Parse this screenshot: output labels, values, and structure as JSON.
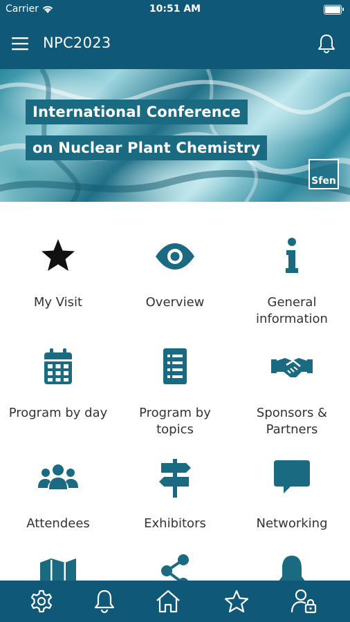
{
  "status_bar": {
    "carrier": "Carrier",
    "time": "10:51 AM"
  },
  "nav": {
    "title": "NPC2023",
    "menu_icon": "hamburger-menu-icon",
    "notification_icon": "bell-icon"
  },
  "banner": {
    "line1": "International Conference",
    "line2": "on Nuclear Plant Chemistry",
    "logo": "Sfen"
  },
  "menu": [
    {
      "label": "My Visit",
      "icon": "star-icon"
    },
    {
      "label": "Overview",
      "icon": "eye-icon"
    },
    {
      "label": "General\ninformation",
      "icon": "info-icon"
    },
    {
      "label": "Program by day",
      "icon": "calendar-icon"
    },
    {
      "label": "Program by\ntopics",
      "icon": "list-icon"
    },
    {
      "label": "Sponsors &\nPartners",
      "icon": "handshake-icon"
    },
    {
      "label": "Attendees",
      "icon": "users-icon"
    },
    {
      "label": "Exhibitors",
      "icon": "signpost-icon"
    },
    {
      "label": "Networking",
      "icon": "chat-icon"
    },
    {
      "label": "",
      "icon": "map-icon"
    },
    {
      "label": "",
      "icon": "share-icon"
    },
    {
      "label": "",
      "icon": "bell-icon"
    }
  ],
  "tabbar": [
    "settings-icon",
    "bell-icon",
    "home-icon",
    "star-icon",
    "user-lock-icon"
  ],
  "colors": {
    "primary": "#0f5878",
    "icon": "#1a6a82",
    "text": "#333333"
  }
}
